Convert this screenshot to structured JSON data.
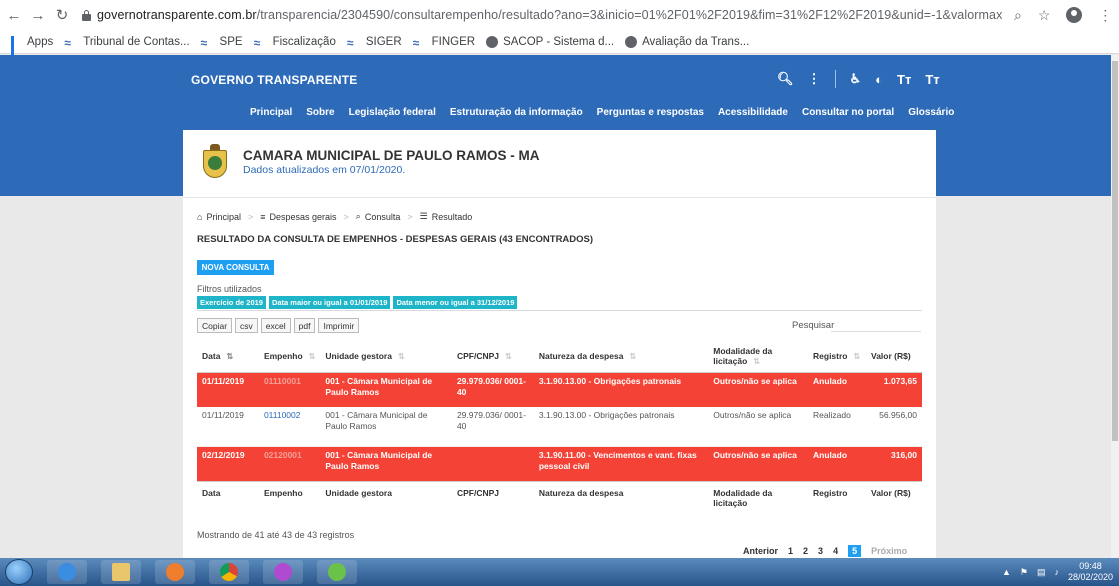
{
  "browser": {
    "url_host": "governotransparente.com.br",
    "url_path": "/transparencia/2304590/consultarempenho/resultado?ano=3&inicio=01%2F01%2F2019&fim=31%2F12%2F2019&unid=-1&valormax=&valorm...",
    "bookmarks": [
      {
        "label": "Apps",
        "icon": "apps-grid-icon"
      },
      {
        "label": "Tribunal de Contas...",
        "icon": "bookmark-logo-icon"
      },
      {
        "label": "SPE",
        "icon": "bookmark-logo-icon"
      },
      {
        "label": "Fiscalização",
        "icon": "bookmark-logo-icon"
      },
      {
        "label": "SIGER",
        "icon": "bookmark-logo-icon"
      },
      {
        "label": "FINGER",
        "icon": "bookmark-logo-icon"
      },
      {
        "label": "SACOP - Sistema d...",
        "icon": "globe-icon"
      },
      {
        "label": "Avaliação da Trans...",
        "icon": "globe-icon"
      }
    ]
  },
  "site": {
    "brand": "GOVERNO TRANSPARENTE",
    "nav": [
      "Principal",
      "Sobre",
      "Legislação federal",
      "Estruturação da informação",
      "Perguntas e respostas",
      "Acessibilidade",
      "Consultar no portal",
      "Glossário"
    ]
  },
  "org": {
    "name": "CAMARA MUNICIPAL DE PAULO RAMOS - MA",
    "updated": "Dados atualizados em 07/01/2020."
  },
  "breadcrumb": [
    "Principal",
    "Despesas gerais",
    "Consulta",
    "Resultado"
  ],
  "page_title": "RESULTADO DA CONSULTA DE EMPENHOS - DESPESAS GERAIS (43 ENCONTRADOS)",
  "new_query_button": "NOVA CONSULTA",
  "filters_label": "Filtros utilizados",
  "filters": [
    "Exercício de 2019",
    "Data maior ou igual a 01/01/2019",
    "Data menor ou igual a 31/12/2019"
  ],
  "export_buttons": [
    "Copiar",
    "csv",
    "excel",
    "pdf",
    "Imprimir"
  ],
  "search_label": "Pesquisar",
  "table": {
    "headers": [
      "Data",
      "Empenho",
      "Unidade gestora",
      "CPF/CNPJ",
      "Natureza da despesa",
      "Modalidade da licitação",
      "Registro",
      "Valor (R$)"
    ],
    "rows": [
      {
        "data": "01/11/2019",
        "empenho": "01110001",
        "unidade": "001 - Câmara Municipal de Paulo Ramos",
        "cpf": "29.979.036/ 0001-40",
        "natureza": "3.1.90.13.00 - Obrigações patronais",
        "modalidade": "Outros/não se aplica",
        "registro": "Anulado",
        "valor": "1.073,65",
        "status": "red"
      },
      {
        "data": "01/11/2019",
        "empenho": "01110002",
        "unidade": "001 - Câmara Municipal de Paulo Ramos",
        "cpf": "29.979.036/ 0001-40",
        "natureza": "3.1.90.13.00 - Obrigações patronais",
        "modalidade": "Outros/não se aplica",
        "registro": "Realizado",
        "valor": "56.956,00",
        "status": "white"
      },
      {
        "data": "02/12/2019",
        "empenho": "02120001",
        "unidade": "001 - Câmara Municipal de Paulo Ramos",
        "cpf": "",
        "natureza": "3.1.90.11.00 - Vencimentos e vant. fixas pessoal civil",
        "modalidade": "Outros/não se aplica",
        "registro": "Anulado",
        "valor": "316,00",
        "status": "red"
      }
    ]
  },
  "showing": "Mostrando de 41 até 43 de 43 registros",
  "pager": {
    "prev": "Anterior",
    "pages": [
      "1",
      "2",
      "3",
      "4",
      "5"
    ],
    "active": "5",
    "next": "Próximo"
  },
  "taskbar": {
    "time": "09:48",
    "date": "28/02/2020"
  },
  "colors": {
    "header_blue": "#2d6bb8",
    "row_red": "#f44336",
    "chip_cyan": "#1fb5c9",
    "button_blue": "#1e9ff2"
  }
}
